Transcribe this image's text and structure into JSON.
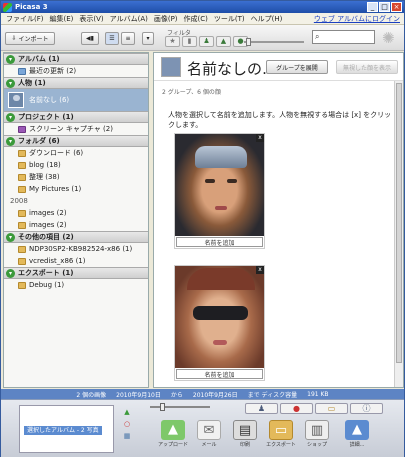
{
  "window": {
    "title": "Picasa 3"
  },
  "menu": {
    "items": [
      "ファイル(F)",
      "編集(E)",
      "表示(V)",
      "アルバム(A)",
      "画像(P)",
      "作成(C)",
      "ツール(T)",
      "ヘルプ(H)"
    ],
    "login": "ウェブ アルバムにログイン"
  },
  "toolbar": {
    "import_label": "インポート",
    "filter_label": "フィルタ"
  },
  "sidebar": {
    "sections": [
      {
        "title": "アルバム (1)",
        "items": [
          "最近の更新 (2)"
        ]
      },
      {
        "title": "人物 (1)",
        "items": [
          "名前なし (6)"
        ]
      },
      {
        "title": "プロジェクト (1)",
        "items": [
          "スクリーン キャプチャ (2)"
        ]
      },
      {
        "title": "フォルダ (6)",
        "items": [
          "ダウンロード (6)",
          "blog (18)",
          "整理 (38)",
          "My Pictures (1)"
        ],
        "year": "2008",
        "items2": [
          "images (2)",
          "images (2)"
        ]
      },
      {
        "title": "その他の項目 (2)",
        "items": [
          "NDP30SP2-KB982524-x86 (1)",
          "vcredist_x86 (1)"
        ]
      },
      {
        "title": "エクスポート (1)",
        "items": [
          "Debug (1)"
        ]
      }
    ]
  },
  "main": {
    "person_name": "名前なしの…",
    "expand_group": "グループを展開",
    "show_ignored": "無視した顔を表示",
    "subtitle": "2 グループ、6 個の顔",
    "message": "人物を選択して名前を追加します。人物を無視する場合は [x] をクリックします。",
    "faces": [
      {
        "add_name": "名前を追加",
        "close": "x"
      },
      {
        "add_name": "名前を追加",
        "close": "x"
      }
    ]
  },
  "status": {
    "count": "2 個の画像",
    "from": "2010年9月10日",
    "to_label": "から",
    "to": "2010年9月26日",
    "disk_label": "まで ディスク容量",
    "disk": "191 KB"
  },
  "tray": {
    "selected_album": "選択したアルバム - 2 写真",
    "actions": [
      {
        "label": "アップロード",
        "icon": "upload-icon"
      },
      {
        "label": "メール",
        "icon": "mail-icon"
      },
      {
        "label": "印刷",
        "icon": "print-icon"
      },
      {
        "label": "エクスポート",
        "icon": "export-icon"
      },
      {
        "label": "ショップ",
        "icon": "shop-icon"
      },
      {
        "label": "詳細...",
        "icon": "more-icon"
      }
    ]
  }
}
